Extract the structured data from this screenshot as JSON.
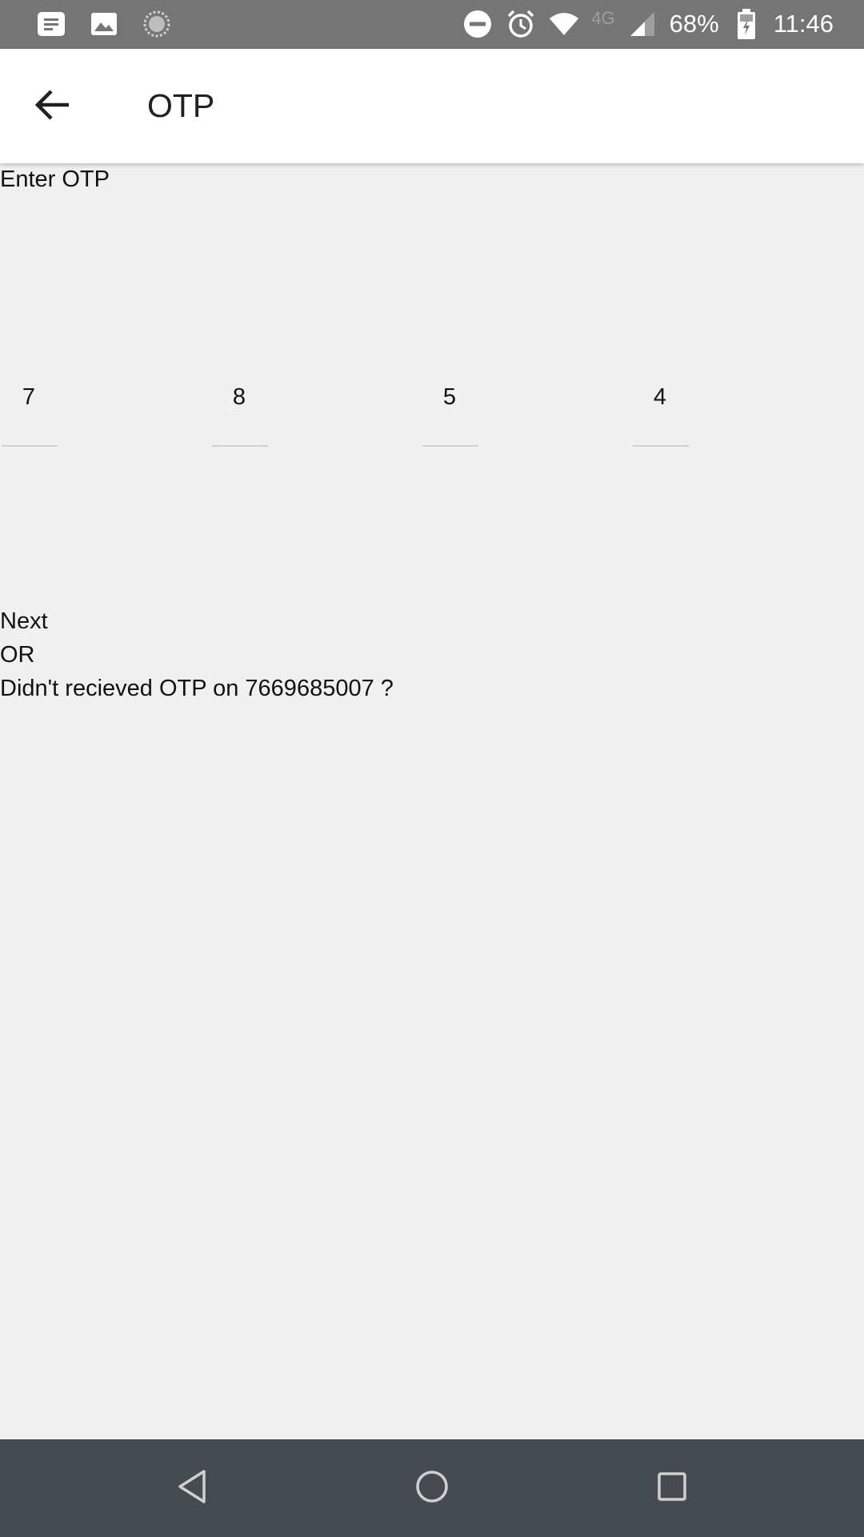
{
  "status_bar": {
    "battery": "68%",
    "time": "11:46",
    "network": "4G",
    "icons": [
      "message-icon",
      "image-icon",
      "sync-icon",
      "do-not-disturb-icon",
      "alarm-icon",
      "wifi-icon",
      "signal-icon",
      "battery-charging-icon"
    ]
  },
  "app_bar": {
    "title": "OTP",
    "back_icon": "arrow-back-icon"
  },
  "main": {
    "enter_label": "Enter OTP",
    "otp_digits": [
      "7",
      "8",
      "5",
      "4"
    ],
    "next_label": "Next",
    "or_label": "OR",
    "resend_text": "Didn't recieved OTP on 7669685007 ?"
  },
  "nav_bar": {
    "icons": [
      "back-triangle-icon",
      "home-circle-icon",
      "recents-square-icon"
    ]
  },
  "colors": {
    "status_bar": "#757575",
    "app_bar": "#ffffff",
    "background": "#f0f0f0",
    "nav_bar": "#454b51"
  }
}
